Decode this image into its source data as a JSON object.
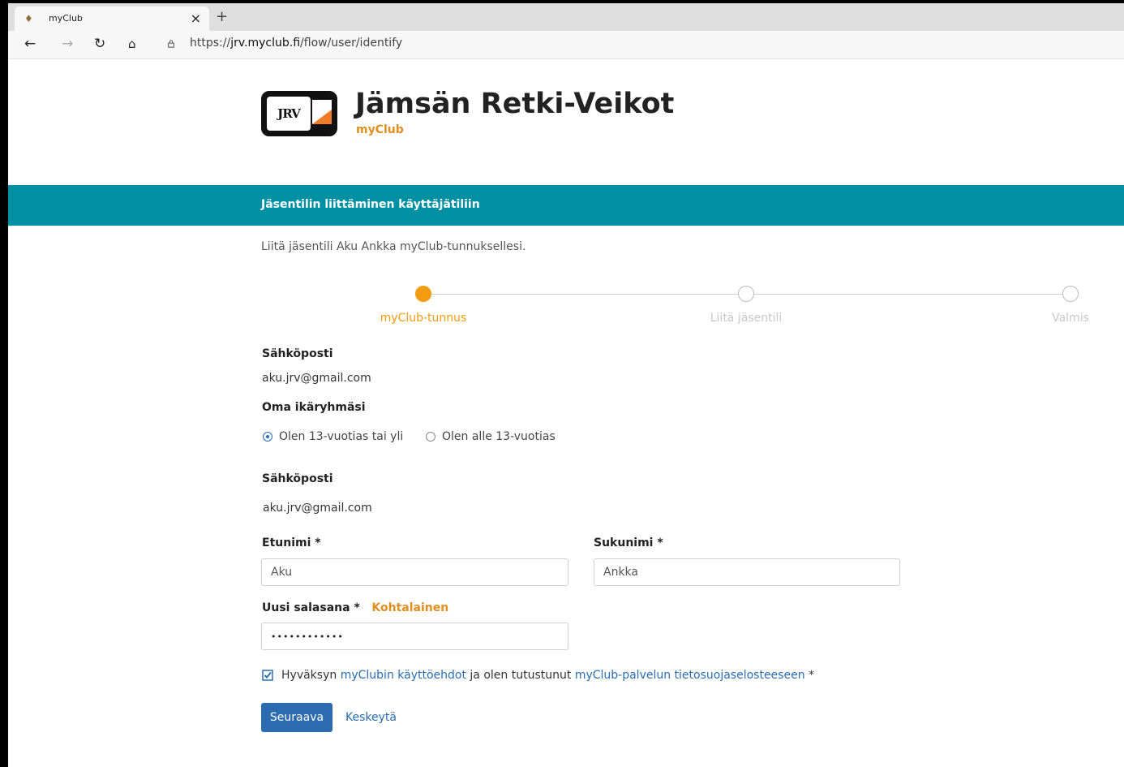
{
  "browser": {
    "tab_title": "myClub",
    "tab_close": "×",
    "new_tab": "+",
    "url_prefix": "https://",
    "url_host": "jrv.myclub.fi",
    "url_path": "/flow/user/identify"
  },
  "header": {
    "logo_text": "JRV",
    "club_name": "Jämsän Retki-Veikot",
    "app_name": "myClub"
  },
  "banner": {
    "title": "Jäsentilin liittäminen käyttäjätiliin"
  },
  "intro": "Liitä jäsentili Aku Ankka myClub-tunnuksellesi.",
  "steps": [
    {
      "label": "myClub-tunnus",
      "active": true
    },
    {
      "label": "Liitä jäsentili",
      "active": false
    },
    {
      "label": "Valmis",
      "active": false
    }
  ],
  "colors": {
    "accent": "#f39c12",
    "banner": "#0090a3",
    "link": "#2a6db0",
    "button": "#2b6cb0"
  },
  "form": {
    "email_label_1": "Sähköposti",
    "email_value_1": "aku.jrv@gmail.com",
    "age_label": "Oma ikäryhmäsi",
    "age_options": [
      "Olen 13-vuotias tai yli",
      "Olen alle 13-vuotias"
    ],
    "age_selected": "Olen 13-vuotias tai yli",
    "email_label_2": "Sähköposti",
    "email_value_2": "aku.jrv@gmail.com",
    "first_name_label": "Etunimi",
    "first_name_value": "Aku",
    "last_name_label": "Sukunimi",
    "last_name_value": "Ankka",
    "required_mark": "*",
    "password_label": "Uusi salasana",
    "password_strength": "Kohtalainen",
    "password_value": "••••••••••••",
    "terms_prefix": "Hyväksyn",
    "terms_link": "myClubin käyttöehdot",
    "terms_middle": "ja olen tutustunut",
    "privacy_link": "myClub-palvelun tietosuojaselosteeseen",
    "terms_checked": true
  },
  "actions": {
    "next": "Seuraava",
    "cancel": "Keskeytä"
  }
}
